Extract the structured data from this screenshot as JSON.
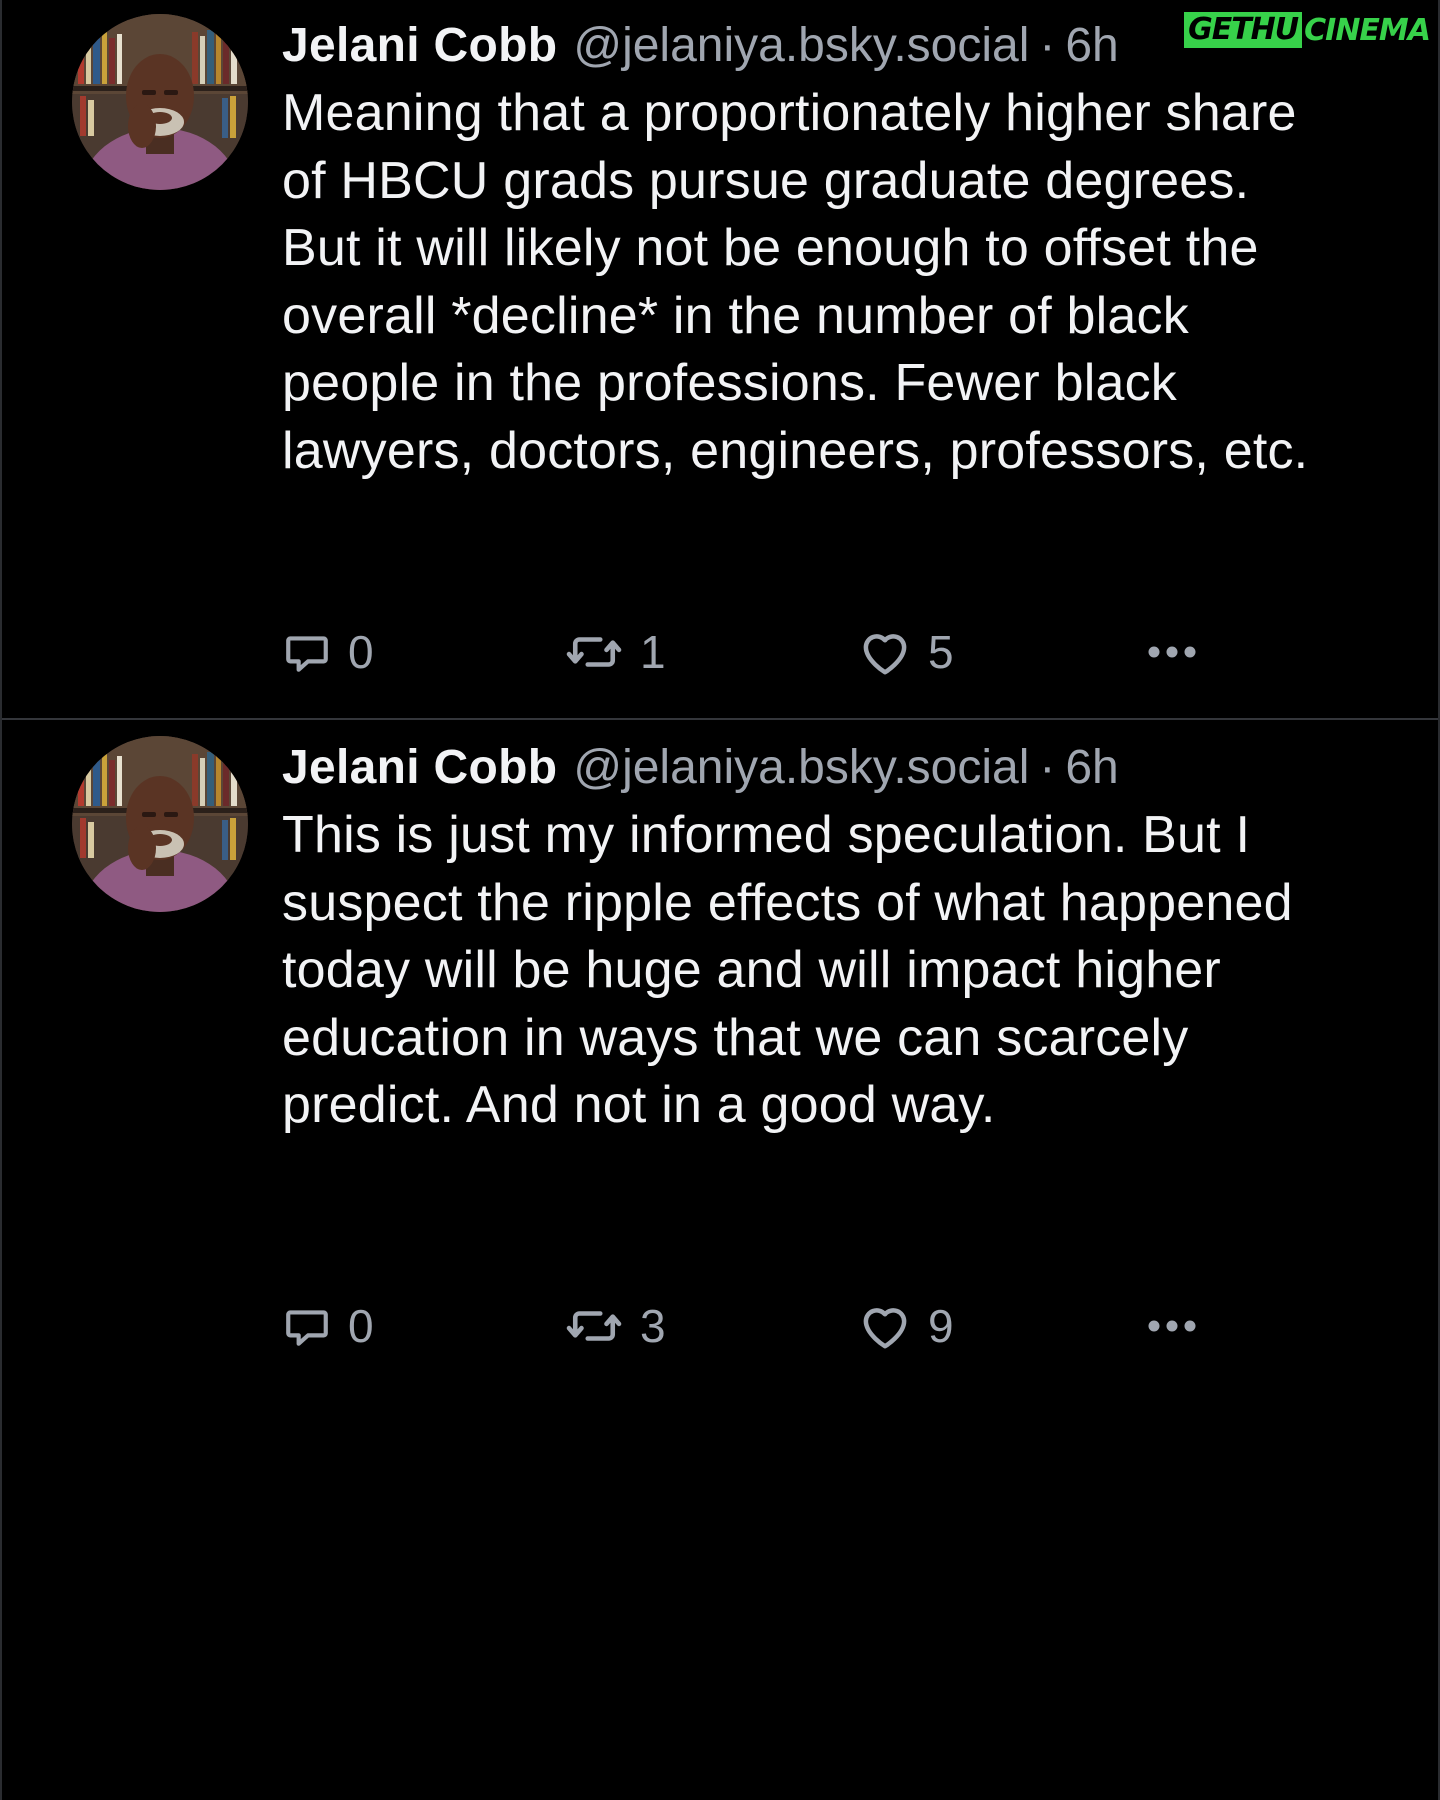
{
  "watermark": {
    "part1": "GETHU",
    "part2": "CINEMA"
  },
  "posts": [
    {
      "author": {
        "display_name": "Jelani Cobb",
        "handle": "@jelaniya.bsky.social",
        "avatar_icon": "avatar-photo"
      },
      "separator": "·",
      "time": "6h",
      "text": "Meaning that a proportionately higher share of HBCU grads pursue graduate degrees. But it will likely not be enough to offset the overall *decline* in the number of black people in the professions. Fewer black lawyers, doctors, engineers, professors, etc.",
      "actions": {
        "reply_icon": "reply-bubble-icon",
        "reply_count": "0",
        "repost_icon": "repost-icon",
        "repost_count": "1",
        "like_icon": "heart-icon",
        "like_count": "5",
        "more_icon": "ellipsis-icon"
      }
    },
    {
      "author": {
        "display_name": "Jelani Cobb",
        "handle": "@jelaniya.bsky.social",
        "avatar_icon": "avatar-photo"
      },
      "separator": "·",
      "time": "6h",
      "text": "This is just my informed speculation. But I suspect the ripple effects of what happened today will be huge and will impact higher education in ways that we can scarcely predict. And not in a good way.",
      "actions": {
        "reply_icon": "reply-bubble-icon",
        "reply_count": "0",
        "repost_icon": "repost-icon",
        "repost_count": "3",
        "like_icon": "heart-icon",
        "like_count": "9",
        "more_icon": "ellipsis-icon"
      }
    }
  ],
  "colors": {
    "background": "#000000",
    "text_primary": "#f2f3f5",
    "text_secondary": "#a0a6b0",
    "divider": "#34363b",
    "watermark_green": "#37d14a"
  }
}
